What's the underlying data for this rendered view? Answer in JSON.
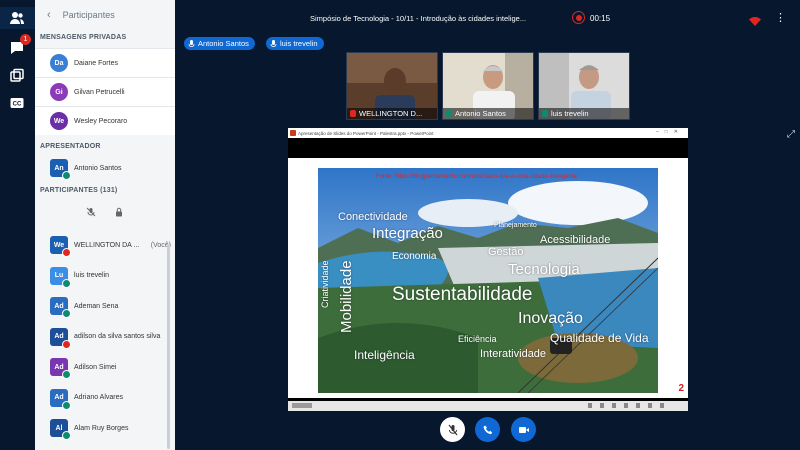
{
  "sidebar": {
    "header_title": "Participantes",
    "private_messages_title": "MENSAGENS PRIVADAS",
    "private_messages": [
      {
        "initials": "Da",
        "name": "Daiane Fortes",
        "color": "#3a7fd6"
      },
      {
        "initials": "Gi",
        "name": "Gilvan Petrucelli",
        "color": "#8b3bb8"
      },
      {
        "initials": "We",
        "name": "Wesley Pecoraro",
        "color": "#6a2ea6"
      }
    ],
    "presenter_title": "APRESENTADOR",
    "presenter": {
      "initials": "An",
      "name": "Antonio Santos",
      "color": "#1b5fb0"
    },
    "participants_title": "PARTICIPANTES (131)",
    "participants": [
      {
        "initials": "We",
        "name": "WELLINGTON DA ...",
        "suffix": "(Você)",
        "color": "#1b5fb0",
        "mic": "red"
      },
      {
        "initials": "Lu",
        "name": "luis trevelin",
        "suffix": "",
        "color": "#3a8ee6",
        "mic": "green"
      },
      {
        "initials": "Ad",
        "name": "Ademan Sena",
        "suffix": "",
        "color": "#2a6cc0",
        "mic": "green"
      },
      {
        "initials": "Ad",
        "name": "adilson da silva santos silva",
        "suffix": "",
        "color": "#1d4f99",
        "mic": "red"
      },
      {
        "initials": "Ad",
        "name": "Adilson Simei",
        "suffix": "",
        "color": "#7a36b0",
        "mic": "green"
      },
      {
        "initials": "Ad",
        "name": "Adriano Alvares",
        "suffix": "",
        "color": "#2a6cc0",
        "mic": "green"
      },
      {
        "initials": "Al",
        "name": "Alam Ruy Borges",
        "suffix": "",
        "color": "#1d4f99",
        "mic": "green"
      }
    ],
    "notification_count": "1"
  },
  "meeting": {
    "title": "Simpósio de Tecnologia - 10/11 - Introdução às cidades intelige...",
    "timer": "00:15"
  },
  "talkers": [
    "Antonio Santos",
    "luis trevelin"
  ],
  "cameras": [
    {
      "name": "WELLINGTON D...",
      "mic": "red"
    },
    {
      "name": "Antonio Santos",
      "mic": "green"
    },
    {
      "name": "luis trevelin",
      "mic": "green"
    }
  ],
  "screen_share": {
    "window_title": "Apresentação de Slides do PowerPoint - Palestra.pptx - PowerPoint",
    "source": "Fonte: https://blogpensamento.com/noticias/o-que-e-uma-cidade-inteligente",
    "page_number": "2",
    "words": [
      "Conectividade",
      "Integração",
      "Planejamento",
      "Acessibilidade",
      "Economia",
      "Gestão",
      "Tecnologia",
      "Criatividade",
      "Mobilidade",
      "Sustentabilidade",
      "Inovação",
      "Eficiência",
      "Qualidade de Vida",
      "Inteligência",
      "Interatividade"
    ]
  },
  "colors": {
    "background": "#06172e",
    "accent": "#0f68d4",
    "danger": "#df2721",
    "mic_on": "#0f8a6f"
  }
}
